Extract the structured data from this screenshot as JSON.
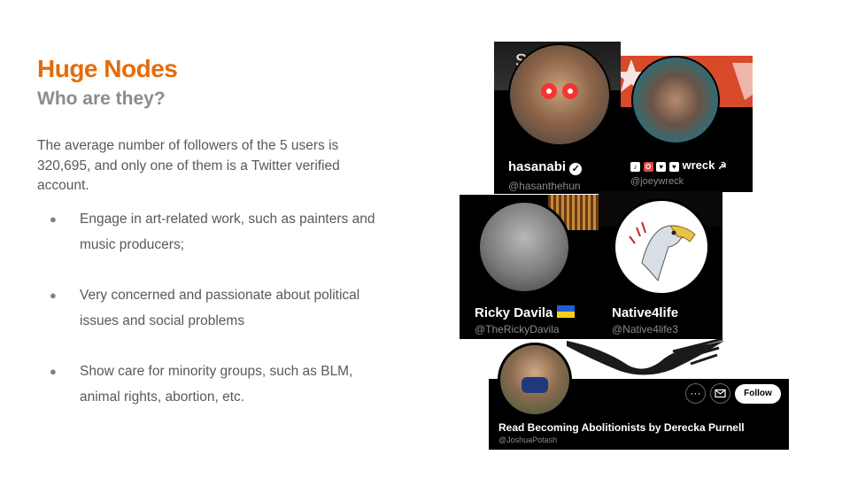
{
  "slide": {
    "title": "Huge Nodes",
    "subtitle": "Who are they?",
    "intro": "The average number of followers of the 5 users is 320,695, and only one of them is a Twitter verified account.",
    "bullets": [
      "Engage in art-related work, such as painters and music producers;",
      "Very concerned and passionate about political issues and social problems",
      "Show care for minority groups, such as BLM, animal rights, abortion, etc."
    ],
    "bullet_glyph": "●"
  },
  "cards": [
    {
      "name": "hasanabi",
      "handle": "@hasanthehun",
      "banner_text": "s   for",
      "verified": true,
      "icon": "verified-badge-icon"
    },
    {
      "name": "wreck",
      "name_prefix": [
        "♪",
        "O",
        "♥",
        "♥"
      ],
      "name_suffix": "☭",
      "handle": "@joeywreck"
    },
    {
      "name": "Ricky Davila",
      "handle": "@TheRickyDavila",
      "flag_icon": "ukraine-flag-icon"
    },
    {
      "name": "Native4life",
      "handle": "@Native4life3"
    },
    {
      "name": "Read Becoming Abolitionists by Derecka Purnell",
      "handle": "@JoshuaPotash",
      "more_icon": "more-icon",
      "message_icon": "mail-icon",
      "follow_label": "Follow"
    }
  ],
  "colors": {
    "title": "#e46c0a",
    "subtitle": "#8c8c8c",
    "body_text": "#595959",
    "card_bg": "#000000",
    "handle": "#8b8b8b",
    "banner_red": "#d84a2a"
  }
}
